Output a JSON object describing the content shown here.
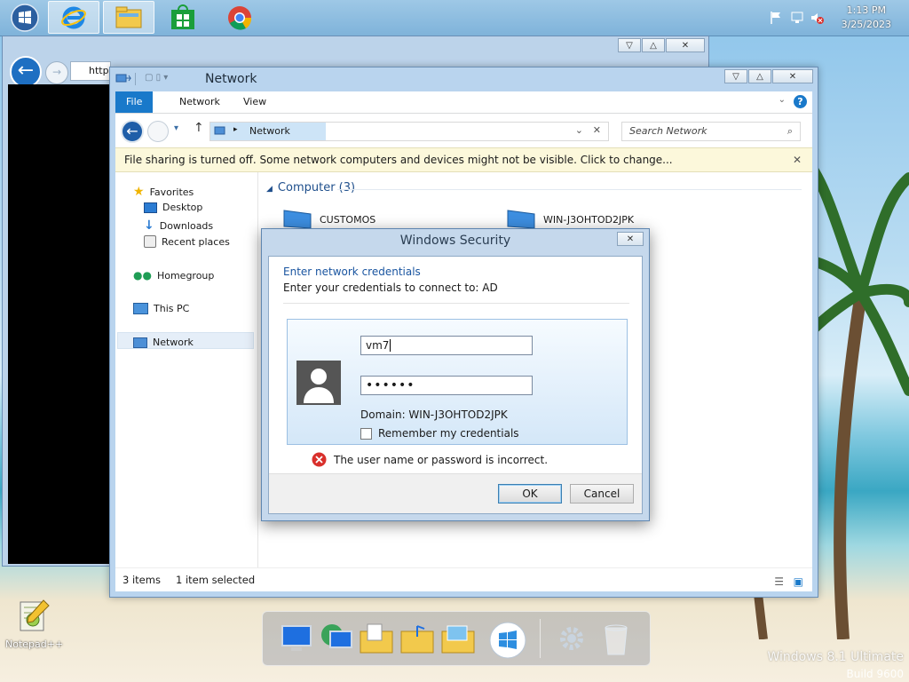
{
  "taskbar": {
    "clock_time": "1:13 PM",
    "clock_date": "3/25/2023"
  },
  "ie": {
    "address_text": "http"
  },
  "explorer": {
    "title": "Network",
    "tabs": [
      "File",
      "Network",
      "View"
    ],
    "address": "Network",
    "search_placeholder": "Search Network",
    "infobar": "File sharing is turned off. Some network computers and devices might not be visible. Click to change...",
    "nav": {
      "favorites": "Favorites",
      "desktop": "Desktop",
      "downloads": "Downloads",
      "recent": "Recent places",
      "homegroup": "Homegroup",
      "thispc": "This PC",
      "network": "Network"
    },
    "group_header": "Computer (3)",
    "computers": [
      "CUSTOMOS",
      "WIN-J3OHTOD2JPK"
    ],
    "status_items": "3 items",
    "status_selected": "1 item selected"
  },
  "dialog": {
    "title": "Windows Security",
    "heading": "Enter network credentials",
    "subheading": "Enter your credentials to connect to: AD",
    "username_value": "vm7",
    "password_value": "••••••",
    "domain_text": "Domain: WIN-J3OHTOD2JPK",
    "remember_label": "Remember my credentials",
    "error_text": "The user name or password is incorrect.",
    "ok_label": "OK",
    "cancel_label": "Cancel"
  },
  "desktop": {
    "notepad_label": "Notepad++",
    "watermark_line1": "Windows 8.1 Ultimate",
    "watermark_line2": "Build 9600"
  },
  "colors": {
    "accent": "#1979ca",
    "infobar_bg": "#fcf8db",
    "error": "#d9302c"
  }
}
